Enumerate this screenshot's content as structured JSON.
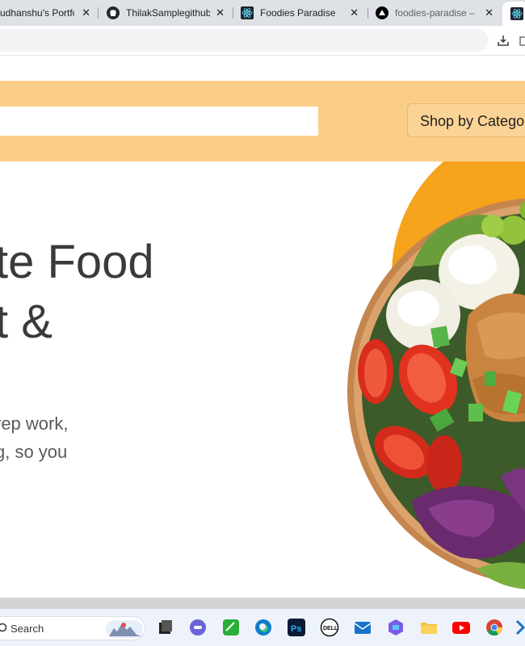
{
  "browser": {
    "tabs": [
      {
        "title": "udhanshu's Portfo",
        "favicon": "generic-icon",
        "active": false
      },
      {
        "title": "ThilakSamplegithub/",
        "favicon": "github-icon",
        "active": false
      },
      {
        "title": "Foodies Paradise",
        "favicon": "react-icon",
        "active": false
      },
      {
        "title": "foodies-paradise – O",
        "favicon": "vercel-icon",
        "active": false
      },
      {
        "title": "",
        "favicon": "react-icon",
        "active": true
      }
    ],
    "close_glyph": "✕"
  },
  "page": {
    "search": {
      "value": "",
      "placeholder": ""
    },
    "shop_button_label": "Shop by Catego",
    "hero_lines": [
      "te Food",
      "t &"
    ],
    "hero_sub_lines": [
      "rep work,",
      "g, so you"
    ],
    "colors": {
      "banner": "#fbce88",
      "accent": "#f5a21c",
      "hero_text": "#3a3a3a"
    }
  },
  "taskbar": {
    "search_label": "Search",
    "icons": [
      "file-explorer-dark-icon",
      "teams-icon",
      "notes-icon",
      "edge-icon",
      "photoshop-icon",
      "dell-icon",
      "mail-icon",
      "copilot-icon",
      "folder-icon",
      "youtube-icon",
      "chrome-icon"
    ]
  }
}
